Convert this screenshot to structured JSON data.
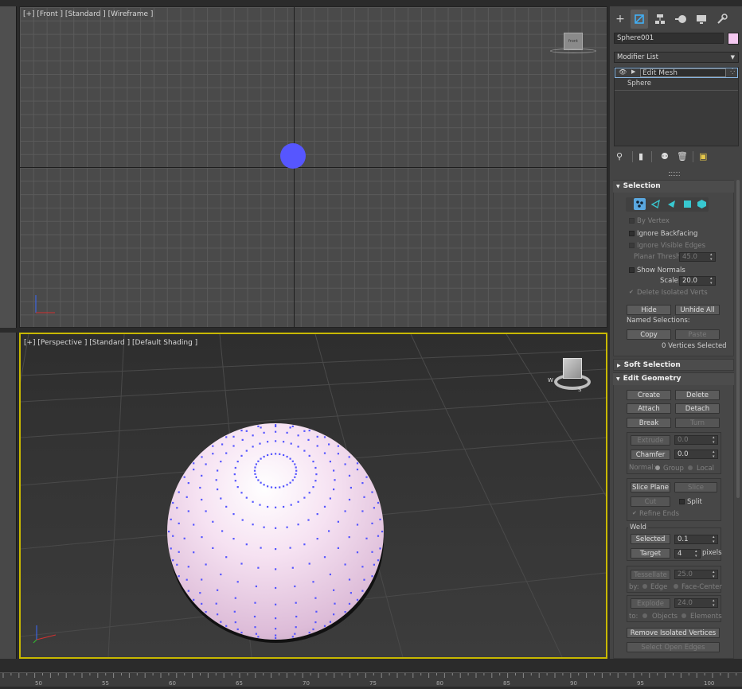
{
  "viewports": {
    "front_label": "[+] [Front ] [Standard ] [Wireframe ]",
    "persp_label": "[+] [Perspective ] [Standard ] [Default Shading ]",
    "viewcube_front": "front",
    "compass_letters": {
      "w": "W",
      "s": "S"
    }
  },
  "panel": {
    "tab_icons": [
      "create-icon",
      "modify-icon",
      "hierarchy-icon",
      "motion-icon",
      "display-icon",
      "utilities-icon"
    ],
    "object_name": "Sphere001",
    "object_color": "#f4c8f0",
    "modifier_list_label": "Modifier List",
    "stack": {
      "edit_mesh": "Edit Mesh",
      "sphere": "Sphere"
    },
    "selection": {
      "title": "Selection",
      "by_vertex": "By Vertex",
      "ignore_backfacing": "Ignore Backfacing",
      "ignore_visible_edges": "Ignore Visible Edges",
      "planar_thresh_label": "Planar Thresh:",
      "planar_thresh_value": "45.0",
      "show_normals": "Show Normals",
      "scale_label": "Scale:",
      "scale_value": "20.0",
      "delete_isolated": "Delete Isolated Verts",
      "hide": "Hide",
      "unhide_all": "Unhide All",
      "named_selections": "Named Selections:",
      "copy": "Copy",
      "paste": "Paste",
      "status": "0 Vertices Selected"
    },
    "soft_selection": {
      "title": "Soft Selection"
    },
    "edit_geometry": {
      "title": "Edit Geometry",
      "create": "Create",
      "delete": "Delete",
      "attach": "Attach",
      "detach": "Detach",
      "break": "Break",
      "turn": "Turn",
      "extrude": "Extrude",
      "extrude_value": "0.0",
      "chamfer": "Chamfer",
      "chamfer_value": "0.0",
      "normal_label": "Normal:",
      "group": "Group",
      "local": "Local",
      "slice_plane": "Slice Plane",
      "slice": "Slice",
      "cut": "Cut",
      "split": "Split",
      "refine_ends": "Refine Ends",
      "weld": "Weld",
      "selected": "Selected",
      "selected_value": "0.1",
      "target": "Target",
      "target_value": "4",
      "pixels": "pixels",
      "tessellate": "Tessellate",
      "tessellate_value": "25.0",
      "by_label": "by:",
      "edge": "Edge",
      "face_center": "Face-Center",
      "explode": "Explode",
      "explode_value": "24.0",
      "to_label": "to:",
      "objects": "Objects",
      "elements": "Elements",
      "remove_isolated": "Remove Isolated Vertices",
      "select_open_edges": "Select Open Edges"
    }
  },
  "timeline": {
    "ticks": [
      "50",
      "55",
      "60",
      "65",
      "70",
      "75",
      "80",
      "85",
      "90",
      "95",
      "100"
    ]
  },
  "colors": {
    "vertex": "#5555ff",
    "active_viewport_border": "#c8b800",
    "sphere": "#f0d4ec"
  }
}
